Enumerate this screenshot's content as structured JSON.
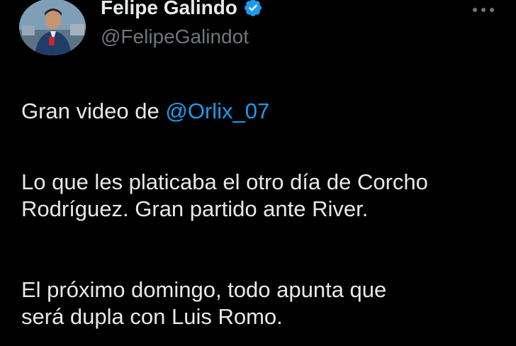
{
  "author": {
    "display_name": "Felipe Galindo",
    "handle": "@FelipeGalindot",
    "verified_icon": "verified-badge-icon",
    "avatar_icon": "profile-photo"
  },
  "more_menu_icon": "more-horizontal-icon",
  "tweet": {
    "line1_prefix": "Gran video de ",
    "line1_mention": "@Orlix_07",
    "p2_line1": "Lo que les platicaba el otro día de Corcho",
    "p2_line2": "Rodríguez. Gran partido ante River.",
    "p3_line1": "El próximo domingo, todo apunta que",
    "p3_line2": "será dupla con Luis Romo."
  },
  "colors": {
    "background": "#000000",
    "text": "#e7e9ea",
    "secondary": "#71767b",
    "accent": "#1d9bf0"
  }
}
